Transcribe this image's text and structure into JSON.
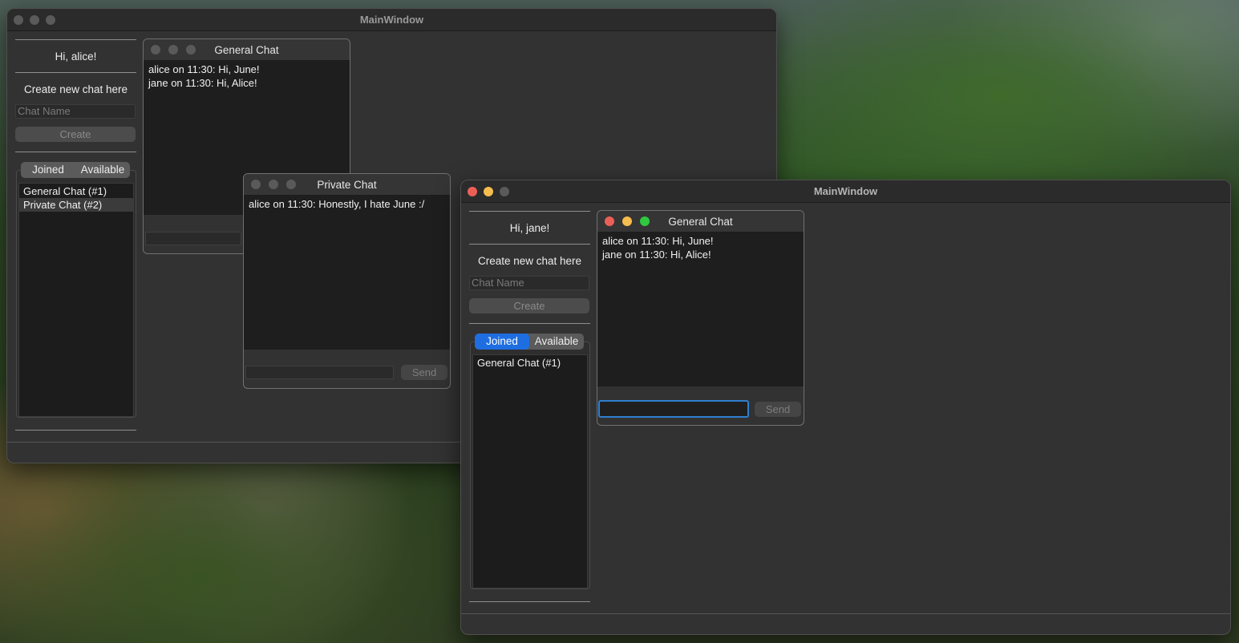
{
  "window_alice": {
    "title": "MainWindow",
    "greeting": "Hi, alice!",
    "create_heading": "Create new chat here",
    "chat_name_placeholder": "Chat Name",
    "create_button": "Create",
    "tabs": {
      "joined": "Joined",
      "available": "Available",
      "selected": "none"
    },
    "chats": [
      "General Chat (#1)",
      "Private Chat (#2)"
    ]
  },
  "alice_general_chat": {
    "title": "General Chat",
    "messages": [
      "alice on 11:30: Hi, June!",
      "jane on 11:30: Hi, Alice!"
    ]
  },
  "alice_private_chat": {
    "title": "Private Chat",
    "messages": [
      "alice on 11:30: Honestly, I hate June :/"
    ],
    "send_button": "Send"
  },
  "window_jane": {
    "title": "MainWindow",
    "greeting": "Hi, jane!",
    "create_heading": "Create new chat here",
    "chat_name_placeholder": "Chat Name",
    "create_button": "Create",
    "tabs": {
      "joined": "Joined",
      "available": "Available",
      "selected": "joined"
    },
    "chats": [
      "General Chat (#1)"
    ]
  },
  "jane_general_chat": {
    "title": "General Chat",
    "messages": [
      "alice on 11:30: Hi, June!",
      "jane on 11:30: Hi, Alice!"
    ],
    "send_button": "Send"
  },
  "colors": {
    "accent": "#1e6ee1",
    "close": "#ec5f57",
    "minimize": "#f5bd4f",
    "zoom": "#2fc840"
  }
}
